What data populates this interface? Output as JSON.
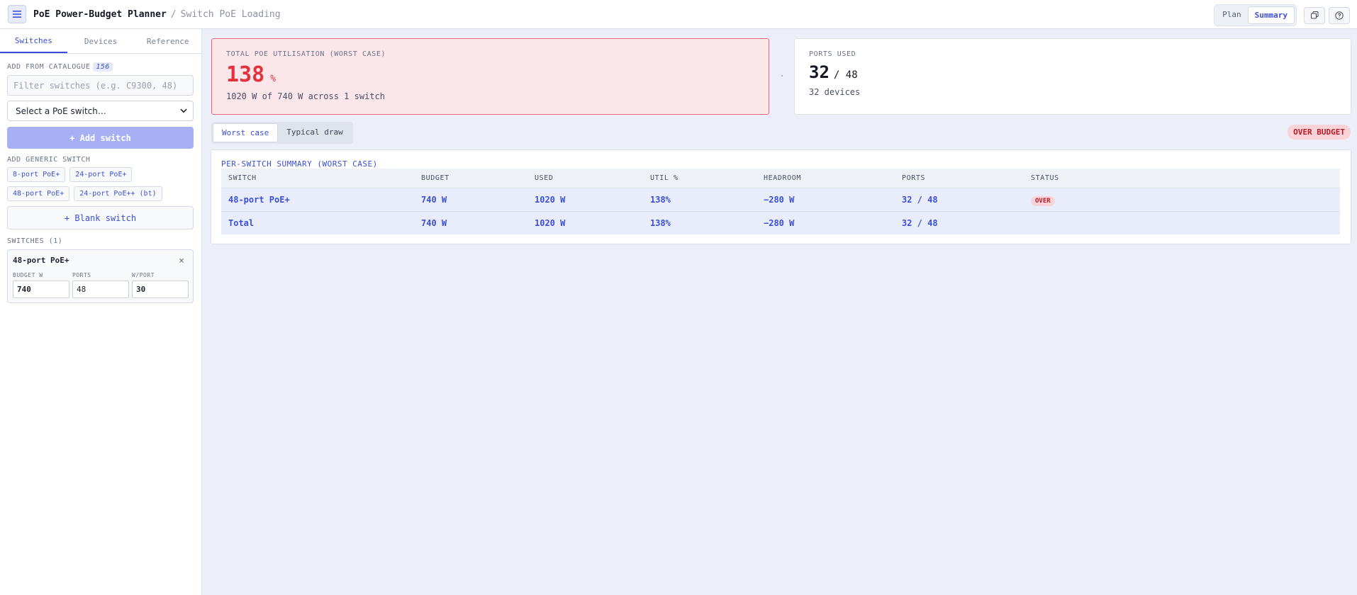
{
  "header": {
    "app_title": "PoE Power-Budget Planner",
    "breadcrumb_sep": "/",
    "breadcrumb": "Switch PoE Loading",
    "view_modes": [
      {
        "label": "Plan",
        "active": false
      },
      {
        "label": "Summary",
        "active": true
      }
    ],
    "icons": [
      "menu-icon",
      "copy-icon",
      "help-icon"
    ]
  },
  "sidebar": {
    "tabs": [
      {
        "label": "Switches",
        "active": true
      },
      {
        "label": "Devices",
        "active": false
      },
      {
        "label": "Reference",
        "active": false
      }
    ],
    "catalogue": {
      "label": "ADD FROM CATALOGUE",
      "count": "156",
      "filter_placeholder": "Filter switches (e.g. C9300, 48)",
      "select_value": "Select a PoE switch…",
      "add_button": "+ Add switch"
    },
    "generic": {
      "label": "ADD GENERIC SWITCH",
      "chips": [
        "8-port PoE+",
        "24-port PoE+",
        "48-port PoE+",
        "24-port PoE++ (bt)"
      ],
      "blank_button": "+ Blank switch"
    },
    "switches": {
      "label": "SWITCHES (1)",
      "items": [
        {
          "name": "48-port PoE+",
          "close": "×",
          "budget_label": "BUDGET W",
          "budget_value": "740",
          "ports_label": "PORTS",
          "ports_value": "48",
          "wport_label": "W/PORT",
          "wport_value": "30"
        }
      ]
    }
  },
  "main": {
    "utilisation": {
      "label": "TOTAL POE UTILISATION (WORST CASE)",
      "value": "138",
      "unit": "%",
      "sub": "1020 W of 740 W across 1 switch"
    },
    "ports": {
      "label": "PORTS USED",
      "used": "32",
      "total": "/ 48",
      "sub": "32 devices"
    },
    "modes": [
      {
        "label": "Worst case",
        "active": true
      },
      {
        "label": "Typical draw",
        "active": false
      }
    ],
    "over_budget_badge": "OVER BUDGET",
    "table": {
      "title": "PER-SWITCH SUMMARY (WORST CASE)",
      "headers": [
        "SWITCH",
        "BUDGET",
        "USED",
        "UTIL %",
        "HEADROOM",
        "PORTS",
        "STATUS"
      ],
      "rows": [
        [
          "48-port PoE+",
          "740 W",
          "1020 W",
          "138%",
          "−280 W",
          "32 / 48",
          "OVER"
        ],
        [
          "Total",
          "740 W",
          "1020 W",
          "138%",
          "−280 W",
          "32 / 48",
          ""
        ]
      ]
    }
  },
  "colors": {
    "accent": "#3b4fd8",
    "danger": "#e2323d",
    "danger_bg": "#fbe6ea",
    "add_button": "#a6b0f2"
  }
}
